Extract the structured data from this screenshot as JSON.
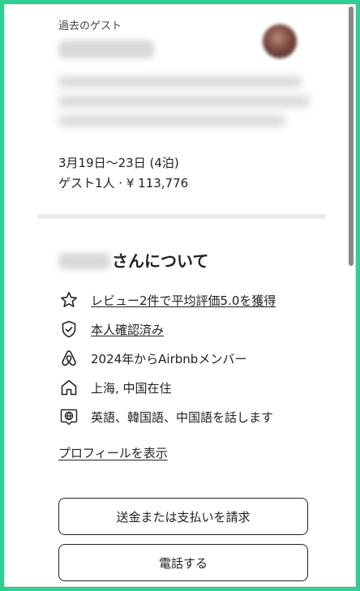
{
  "reservation": {
    "past_guest_label": "過去のゲスト",
    "dates": "3月19日〜23日 (4泊)",
    "guests_price": "ゲスト1人 · ¥ 113,776"
  },
  "about": {
    "title_suffix": "さんについて",
    "facts": [
      {
        "icon": "star-icon",
        "text": "レビュー2件で平均評価5.0を獲得",
        "link": true
      },
      {
        "icon": "shield-check-icon",
        "text": "本人確認済み",
        "link": true
      },
      {
        "icon": "airbnb-logo-icon",
        "text": "2024年からAirbnbメンバー",
        "link": false
      },
      {
        "icon": "home-icon",
        "text": "上海, 中国在住",
        "link": false
      },
      {
        "icon": "globe-speech-icon",
        "text": "英語、韓国語、中国語を話します",
        "link": false
      }
    ],
    "profile_link": "プロフィールを表示"
  },
  "actions": {
    "request_payment": "送金または支払いを請求",
    "call": "電話する"
  },
  "colors": {
    "outer_frame": "#2fcf94",
    "text": "#222222",
    "divider": "#ebebeb"
  }
}
